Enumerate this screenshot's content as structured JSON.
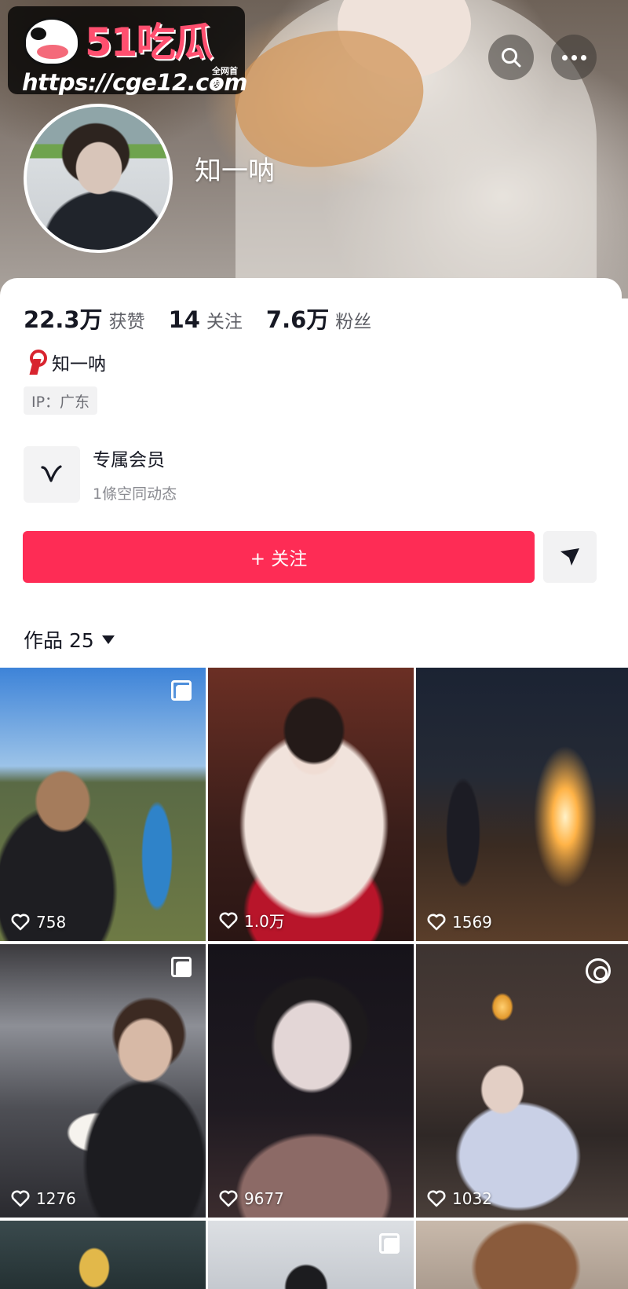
{
  "watermark": {
    "brand": "51吃瓜",
    "tag": "全网首发",
    "url": "https://cge12.com"
  },
  "header": {
    "search_icon": "search-icon",
    "more_icon": "more-dots-icon"
  },
  "profile": {
    "name": "知一呐",
    "stats": [
      {
        "value": "22.3万",
        "label": "获赞"
      },
      {
        "value": "14",
        "label": "关注"
      },
      {
        "value": "7.6万",
        "label": "粉丝"
      }
    ],
    "signature_icon": "red-ribbon-icon",
    "signature": "知一呐",
    "ip": "IP：广东"
  },
  "membership": {
    "icon": "v-logo-icon",
    "title": "专属会员",
    "subtitle": "1條空同动态"
  },
  "actions": {
    "follow_label": "+ 关注",
    "share_icon": "send-arrow-icon"
  },
  "works": {
    "label": "作品 25"
  },
  "videos": [
    {
      "likes": "758",
      "multi": true
    },
    {
      "likes": "1.0万",
      "multi": false
    },
    {
      "likes": "1569",
      "multi": false
    },
    {
      "likes": "1276",
      "multi": true
    },
    {
      "likes": "9677",
      "multi": false
    },
    {
      "likes": "1032",
      "live": true
    },
    {
      "likes": "",
      "multi": false
    },
    {
      "likes": "",
      "multi": true
    },
    {
      "likes": "",
      "multi": false
    }
  ],
  "colors": {
    "accent": "#fe2c55",
    "text": "#161823",
    "secondary_text": "#5e5f66"
  }
}
